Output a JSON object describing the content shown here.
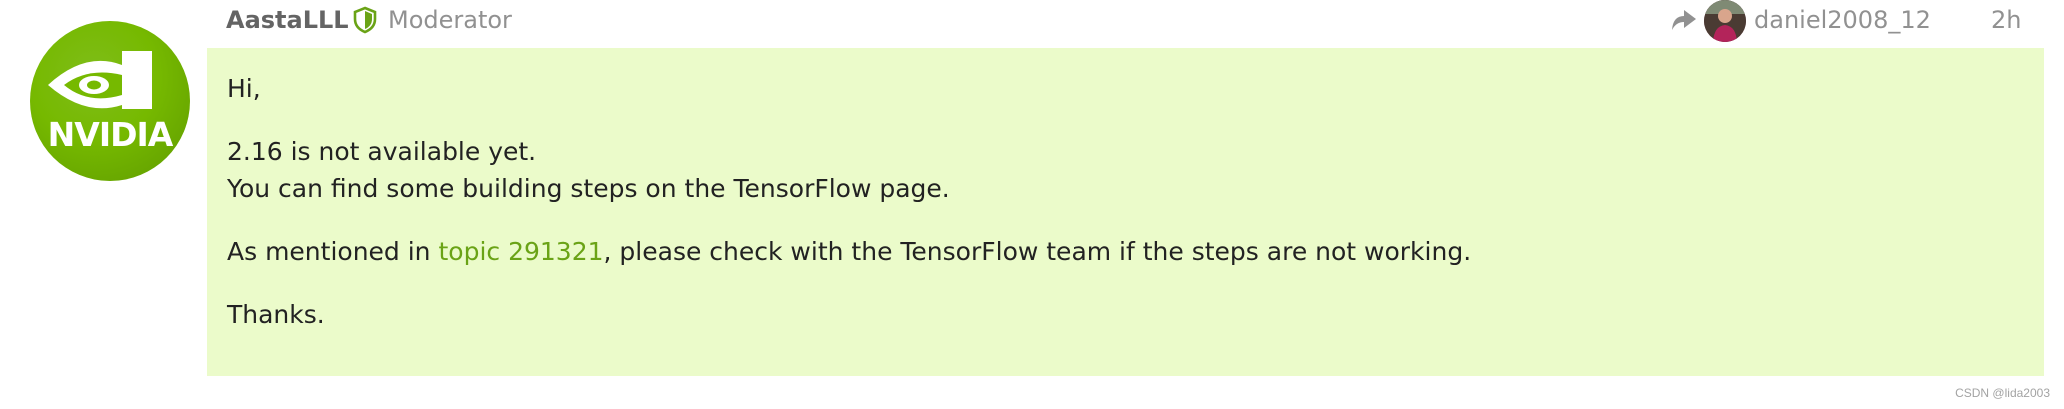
{
  "author": {
    "avatar_logo_text": "NVIDIA",
    "username": "AastaLLL",
    "role": "Moderator",
    "role_icon": "shield-icon"
  },
  "reply_to": {
    "icon": "reply-arrow-icon",
    "username": "daniel2008_12"
  },
  "timestamp": "2h",
  "post": {
    "greeting": "Hi,",
    "line1": "2.16 is not available yet.",
    "line2": "You can find some building steps on the TensorFlow page.",
    "line3_before": "As mentioned in ",
    "line3_link": "topic 291321",
    "line3_after": ", please check with the TensorFlow team if the steps are not working.",
    "closing": "Thanks."
  },
  "watermark": "CSDN @lida2003",
  "colors": {
    "brand_green": "#76b900",
    "post_background": "#ebfbca",
    "link": "#6aa316",
    "muted_text": "#919191"
  }
}
